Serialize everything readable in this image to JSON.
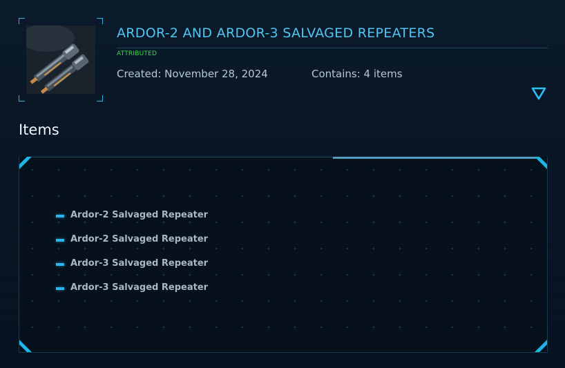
{
  "header": {
    "title": "ARDOR-2 AND ARDOR-3 SALVAGED REPEATERS",
    "status_badge": "ATTRIBUTED",
    "created": "Created: November 28, 2024",
    "contains": "Contains: 4 items",
    "thumbnail_icon": "weapon-thumbnail",
    "expand_icon": "triangle-down-icon"
  },
  "items_section": {
    "heading": "Items",
    "items": [
      {
        "label": "Ardor-2 Salvaged Repeater"
      },
      {
        "label": "Ardor-2 Salvaged Repeater"
      },
      {
        "label": "Ardor-3 Salvaged Repeater"
      },
      {
        "label": "Ardor-3 Salvaged Repeater"
      }
    ]
  },
  "colors": {
    "accent": "#29b6ee",
    "title": "#4fc6f4",
    "badge": "#33e040",
    "background": "#071320"
  }
}
